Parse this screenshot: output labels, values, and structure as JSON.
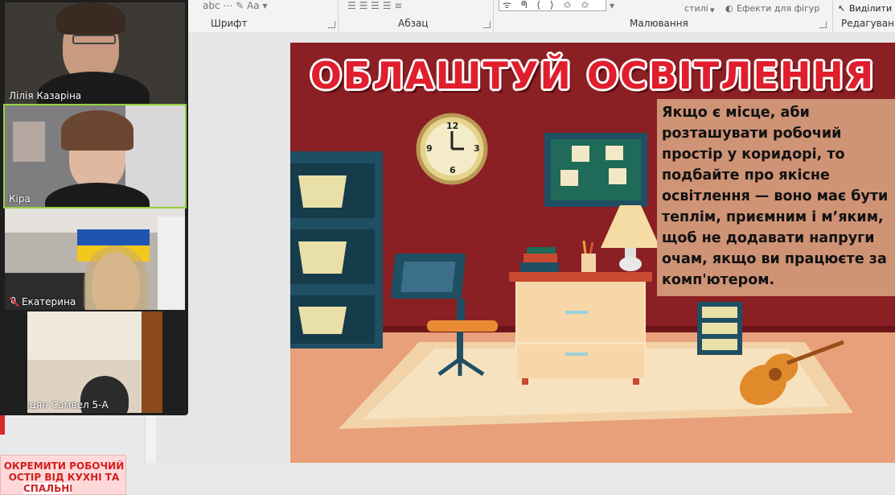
{
  "ribbon": {
    "groups": [
      "Шрифт",
      "Абзац",
      "Малювання",
      "Редагування"
    ],
    "styles_label": "стилі",
    "shape_effects_label": "Ефекти для фігур",
    "select_label": "Виділити",
    "shapes_preview": "ᯤ ᖗ ⟨ ⟩ ✩ ✩"
  },
  "video_participants": [
    {
      "name": "Лілія Казаріна",
      "muted": false
    },
    {
      "name": "Кіра",
      "muted": false
    },
    {
      "name": "Екатерина",
      "muted": true
    },
    {
      "name": "Сарецян Самвел 5-А",
      "muted": false
    }
  ],
  "slide_thumbnail": {
    "lines": [
      "ОКРЕМИТИ РОБОЧИЙ",
      "ОСТІР ВІД КУХНІ ТА",
      "СПАЛЬНІ"
    ]
  },
  "slide": {
    "title": "ОБЛАШТУЙ ОСВІТЛЕННЯ",
    "body_lines": [
      "Якщо є місце, аби",
      "розташувати робочий",
      "простір у коридорі, то",
      "подбайте про якісне",
      "освітлення — воно має бути",
      "теплім, приємним і м’яким,",
      "щоб не додавати напруги",
      "очам, якщо ви працюєте за",
      "комп'ютером."
    ],
    "clock_numbers": [
      "12",
      "3",
      "6",
      "9"
    ]
  },
  "colors": {
    "wall": "#8a1f24",
    "floor": "#e8a07a",
    "title_red": "#e01e2d",
    "text_box": "#cf9376",
    "active_speaker": "#95d13d"
  }
}
